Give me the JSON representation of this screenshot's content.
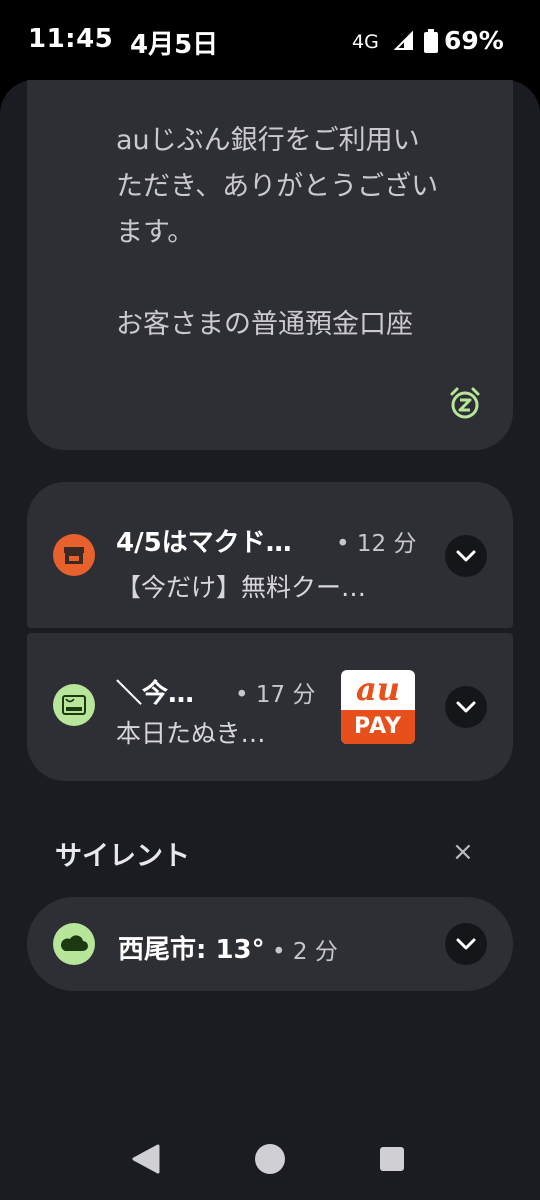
{
  "status_bar": {
    "time": "11:45",
    "date": "4月5日",
    "network": "4G",
    "battery": "69%"
  },
  "notifications": {
    "sms": {
      "body": "auじぶん銀行をご利用い\nただき、ありがとうござい\nます。\n\nお客さまの普通預金口座",
      "snooze_icon": "alarm-snooze-icon",
      "accent": "#b7e59a"
    },
    "mcdonalds": {
      "title": "4/5はマクド…",
      "time": "• 12 分",
      "body": "【今だけ】無料クー…",
      "badge_color": "#e8612c"
    },
    "aupay": {
      "title": "＼今…",
      "time": "• 17 分",
      "body": "本日たぬき…",
      "badge_color": "#b7e59a",
      "logo_top": "au",
      "logo_bottom": "PAY",
      "logo_color": "#e8501b"
    }
  },
  "silent_section": {
    "label": "サイレント",
    "close": "×",
    "weather": {
      "title": "西尾市: 13°",
      "time": "• 2 分",
      "badge_color": "#b7e59a"
    }
  }
}
